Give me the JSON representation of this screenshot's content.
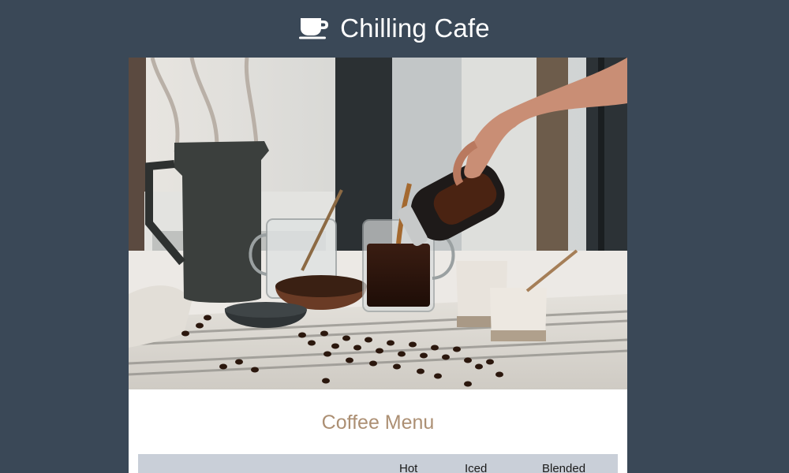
{
  "header": {
    "title": "Chilling Cafe",
    "icon": "coffee-cup-icon"
  },
  "hero": {
    "image": "coffee-pouring-photo"
  },
  "menu": {
    "title": "Coffee Menu",
    "columns": [
      "",
      "Hot",
      "Iced",
      "Blended"
    ]
  },
  "colors": {
    "background": "#3a4857",
    "card": "#ffffff",
    "menu_title": "#ac8f73",
    "table_header": "#c9cfd8"
  }
}
